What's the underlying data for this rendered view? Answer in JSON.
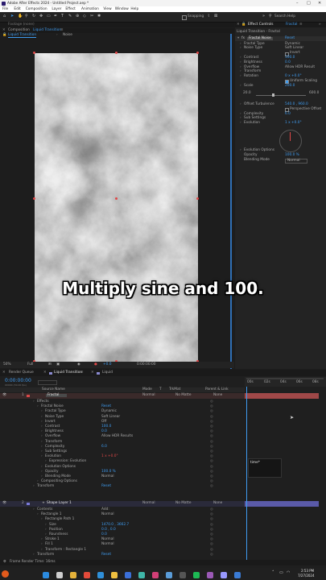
{
  "app": {
    "title": "Adobe After Effects 2024 - Untitled Project.aep *",
    "menu": [
      "File",
      "Edit",
      "Composition",
      "Layer",
      "Effect",
      "Animation",
      "View",
      "Window",
      "Help"
    ],
    "search": "Search Help",
    "snapping": "Snapping"
  },
  "footage_bar": {
    "label": "Footage (none)"
  },
  "comp_panel": {
    "tab": "Composition",
    "tab_name": "Liquid Transition",
    "breadcrumb": [
      "Liquid Transition",
      "Noise"
    ],
    "zoom": "50%",
    "quality": "Full",
    "exposure": "+0.0",
    "timecode": "0:00:00:00"
  },
  "effect_controls": {
    "tab": "Effect Controls",
    "tab_name": "Fractal",
    "header": "Liquid Transition - Fractal",
    "reset_label": "Reset",
    "effect_name": "Fractal Noise",
    "props": [
      {
        "name": "Fractal Type",
        "value": "Dynamic"
      },
      {
        "name": "Noise Type",
        "value": "Soft Linear"
      },
      {
        "name": "",
        "value": "Invert"
      },
      {
        "name": "Contrast",
        "value": "100.0"
      },
      {
        "name": "Brightness",
        "value": "0.0"
      },
      {
        "name": "Overflow",
        "value": "Allow HDR Result"
      },
      {
        "name": "Transform",
        "value": ""
      },
      {
        "name": "Rotation",
        "value": "0 x +0.0°"
      },
      {
        "name": "",
        "value": "Uniform Scaling"
      },
      {
        "name": "Scale",
        "value": "200.0"
      },
      {
        "name": "",
        "value": ""
      },
      {
        "name": "",
        "value": ""
      },
      {
        "name": "",
        "value": ""
      },
      {
        "name": "Offset Turbulence",
        "value": "540.0 , 960.0"
      },
      {
        "name": "",
        "value": "Perspective Offset"
      },
      {
        "name": "Complexity",
        "value": "6.0"
      },
      {
        "name": "Sub Settings",
        "value": ""
      },
      {
        "name": "Evolution",
        "value": "1 x +0.0°"
      }
    ],
    "scale_min": "20.0",
    "scale_max": "600.0",
    "evo_options": "Evolution Options",
    "opacity_label": "Opacity",
    "opacity_value": "100.0 %",
    "blend_label": "Blending Mode",
    "blend_value": "Normal"
  },
  "caption": "Multiply sine and 100.",
  "timeline": {
    "tabs": [
      "Render Queue",
      "Liquid Transition",
      "Liquid"
    ],
    "timecode": "0:00:00:00",
    "fps_note": "00000 (30.00 fps)",
    "cols": [
      "Source Name",
      "Mode",
      "T",
      "TrkMat",
      "Parent & Link"
    ],
    "ruler": [
      "00s",
      "02s",
      "04s",
      "06s",
      "08s"
    ],
    "layer1": {
      "num": "1",
      "name": "Fractal",
      "mode": "Normal",
      "trk": "No Matte",
      "parent": "None"
    },
    "rows": [
      {
        "indent": 1,
        "name": "Effects",
        "value": ""
      },
      {
        "indent": 2,
        "name": "Fractal Noise",
        "value": "Reset"
      },
      {
        "indent": 3,
        "name": "Fractal Type",
        "value": "Dynamic"
      },
      {
        "indent": 3,
        "name": "Noise Type",
        "value": "Soft Linear"
      },
      {
        "indent": 3,
        "name": "Invert",
        "value": "Off"
      },
      {
        "indent": 3,
        "name": "Contrast",
        "value": "100.0"
      },
      {
        "indent": 3,
        "name": "Brightness",
        "value": "0.0"
      },
      {
        "indent": 3,
        "name": "Overflow",
        "value": "Allow HDR Results"
      },
      {
        "indent": 3,
        "name": "Transform",
        "value": ""
      },
      {
        "indent": 3,
        "name": "Complexity",
        "value": "6.0"
      },
      {
        "indent": 3,
        "name": "Sub Settings",
        "value": ""
      },
      {
        "indent": 3,
        "name": "Evolution",
        "value": "1 x +0.0°"
      },
      {
        "indent": 4,
        "name": "Expression: Evolution",
        "value": ""
      },
      {
        "indent": 3,
        "name": "Evolution Options",
        "value": ""
      },
      {
        "indent": 3,
        "name": "Opacity",
        "value": "100.0 %"
      },
      {
        "indent": 3,
        "name": "Blending Mode",
        "value": "Normal"
      },
      {
        "indent": 2,
        "name": "Compositing Options",
        "value": ""
      },
      {
        "indent": 1,
        "name": "Transform",
        "value": "Reset"
      }
    ],
    "layer2": {
      "num": "2",
      "name": "Shape Layer 1",
      "mode": "Normal",
      "trk": "No Matte",
      "parent": "None"
    },
    "rows2": [
      {
        "indent": 1,
        "name": "Contents",
        "value": "Add:"
      },
      {
        "indent": 2,
        "name": "Rectangle 1",
        "value": "Normal"
      },
      {
        "indent": 3,
        "name": "Rectangle Path 1",
        "value": ""
      },
      {
        "indent": 4,
        "name": "Size",
        "value": "1470.0 , 3662.7"
      },
      {
        "indent": 4,
        "name": "Position",
        "value": "0.0 , 0.0"
      },
      {
        "indent": 4,
        "name": "Roundness",
        "value": "0.0"
      },
      {
        "indent": 3,
        "name": "Stroke 1",
        "value": "Normal"
      },
      {
        "indent": 3,
        "name": "Fill 1",
        "value": "Normal"
      },
      {
        "indent": 3,
        "name": "Transform : Rectangle 1",
        "value": ""
      },
      {
        "indent": 1,
        "name": "Transform",
        "value": "Reset"
      }
    ],
    "expression_text": "time*",
    "render_time": "Frame Render Time:  16ms"
  },
  "taskbar": {
    "time": "2:53 PM",
    "date": "7/27/2024",
    "icons": [
      {
        "name": "windows",
        "color": "#2b8be0"
      },
      {
        "name": "search",
        "color": "#cfcfcf"
      },
      {
        "name": "files",
        "color": "#e5b23a"
      },
      {
        "name": "chrome",
        "color": "#e34a3a"
      },
      {
        "name": "vscode",
        "color": "#2f8fd9"
      },
      {
        "name": "folder",
        "color": "#f0c040"
      },
      {
        "name": "store",
        "color": "#3b6fd8"
      },
      {
        "name": "edge",
        "color": "#3fb6a8"
      },
      {
        "name": "media",
        "color": "#d23f77"
      },
      {
        "name": "phone",
        "color": "#5a9cd8"
      },
      {
        "name": "terminal",
        "color": "#555555"
      },
      {
        "name": "spotify",
        "color": "#1db954"
      },
      {
        "name": "photos",
        "color": "#9b59b6"
      },
      {
        "name": "aftereffects",
        "color": "#9999ff"
      },
      {
        "name": "chat",
        "color": "#3a7bd5"
      }
    ]
  }
}
